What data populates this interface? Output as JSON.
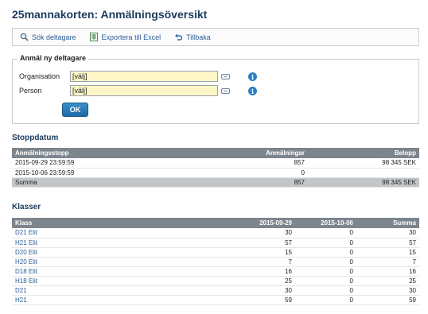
{
  "page": {
    "title": "25mannakorten: Anmälningsöversikt"
  },
  "toolbar": {
    "search_label": "Sök deltagare",
    "export_label": "Exportera till Excel",
    "back_label": "Tillbaka"
  },
  "form": {
    "legend": "Anmäl ny deltagare",
    "organisation_label": "Organisation",
    "organisation_value": "[välj]",
    "person_label": "Person",
    "person_value": "[välj]",
    "ok_label": "OK"
  },
  "stoppdatum": {
    "title": "Stoppdatum",
    "headers": [
      "Anmälningsstopp",
      "Anmälningar",
      "Belopp"
    ],
    "rows": [
      [
        "2015-09-29 23:59:59",
        "857",
        "98 345 SEK"
      ],
      [
        "2015-10-06 23:59:59",
        "0",
        ""
      ]
    ],
    "sum": [
      "Summa",
      "857",
      "98 345 SEK"
    ]
  },
  "klasser": {
    "title": "Klasser",
    "headers": [
      "Klass",
      "2015-09-29",
      "2015-10-06",
      "Summa"
    ],
    "rows": [
      [
        "D21 Elit",
        "30",
        "0",
        "30"
      ],
      [
        "H21 Elit",
        "57",
        "0",
        "57"
      ],
      [
        "D20 Elit",
        "15",
        "0",
        "15"
      ],
      [
        "H20 Elit",
        "7",
        "0",
        "7"
      ],
      [
        "D18 Elit",
        "16",
        "0",
        "16"
      ],
      [
        "H18 Elit",
        "25",
        "0",
        "25"
      ],
      [
        "D21",
        "30",
        "0",
        "30"
      ],
      [
        "H21",
        "59",
        "0",
        "59"
      ]
    ]
  }
}
